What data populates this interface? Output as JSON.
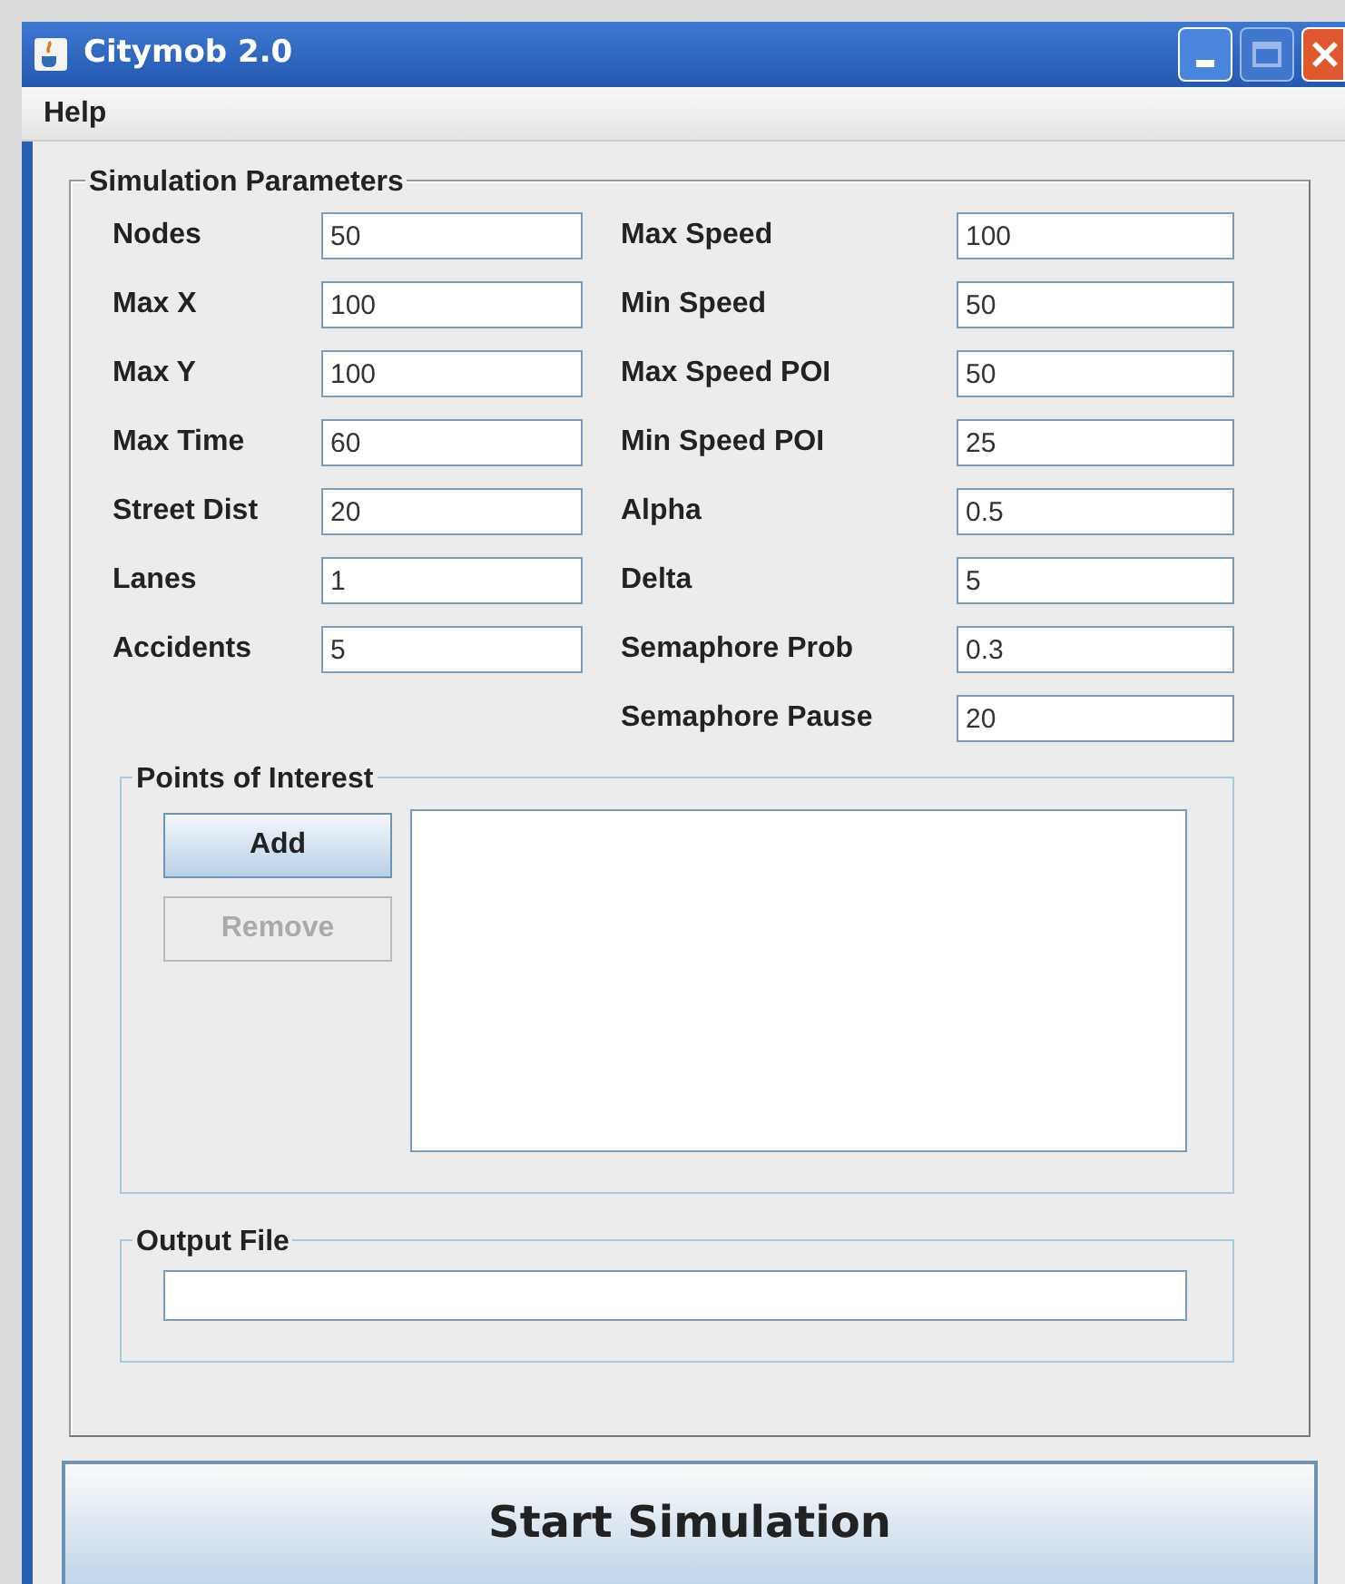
{
  "window": {
    "title": "Citymob 2.0"
  },
  "menu": [
    "Help"
  ],
  "parameters": {
    "title": "Simulation Parameters",
    "left": [
      {
        "label": "Nodes",
        "value": "50"
      },
      {
        "label": "Max X",
        "value": "100"
      },
      {
        "label": "Max Y",
        "value": "100"
      },
      {
        "label": "Max Time",
        "value": "60"
      },
      {
        "label": "Street Dist",
        "value": "20"
      },
      {
        "label": "Lanes",
        "value": "1"
      },
      {
        "label": "Accidents",
        "value": "5"
      }
    ],
    "right": [
      {
        "label": "Max Speed",
        "value": "100"
      },
      {
        "label": "Min Speed",
        "value": "50"
      },
      {
        "label": "Max Speed POI",
        "value": "50"
      },
      {
        "label": "Min Speed POI",
        "value": "25"
      },
      {
        "label": "Alpha",
        "value": "0.5"
      },
      {
        "label": "Delta",
        "value": "5"
      },
      {
        "label": "Semaphore Prob",
        "value": "0.3"
      },
      {
        "label": "Semaphore Pause",
        "value": "20"
      }
    ]
  },
  "points_of_interest": {
    "title": "Points of Interest",
    "buttons": [
      {
        "label": "Add",
        "disabled": false
      },
      {
        "label": "Remove",
        "disabled": true
      }
    ]
  },
  "output_file": {
    "title": "Output File"
  },
  "start_button": "Start Simulation"
}
